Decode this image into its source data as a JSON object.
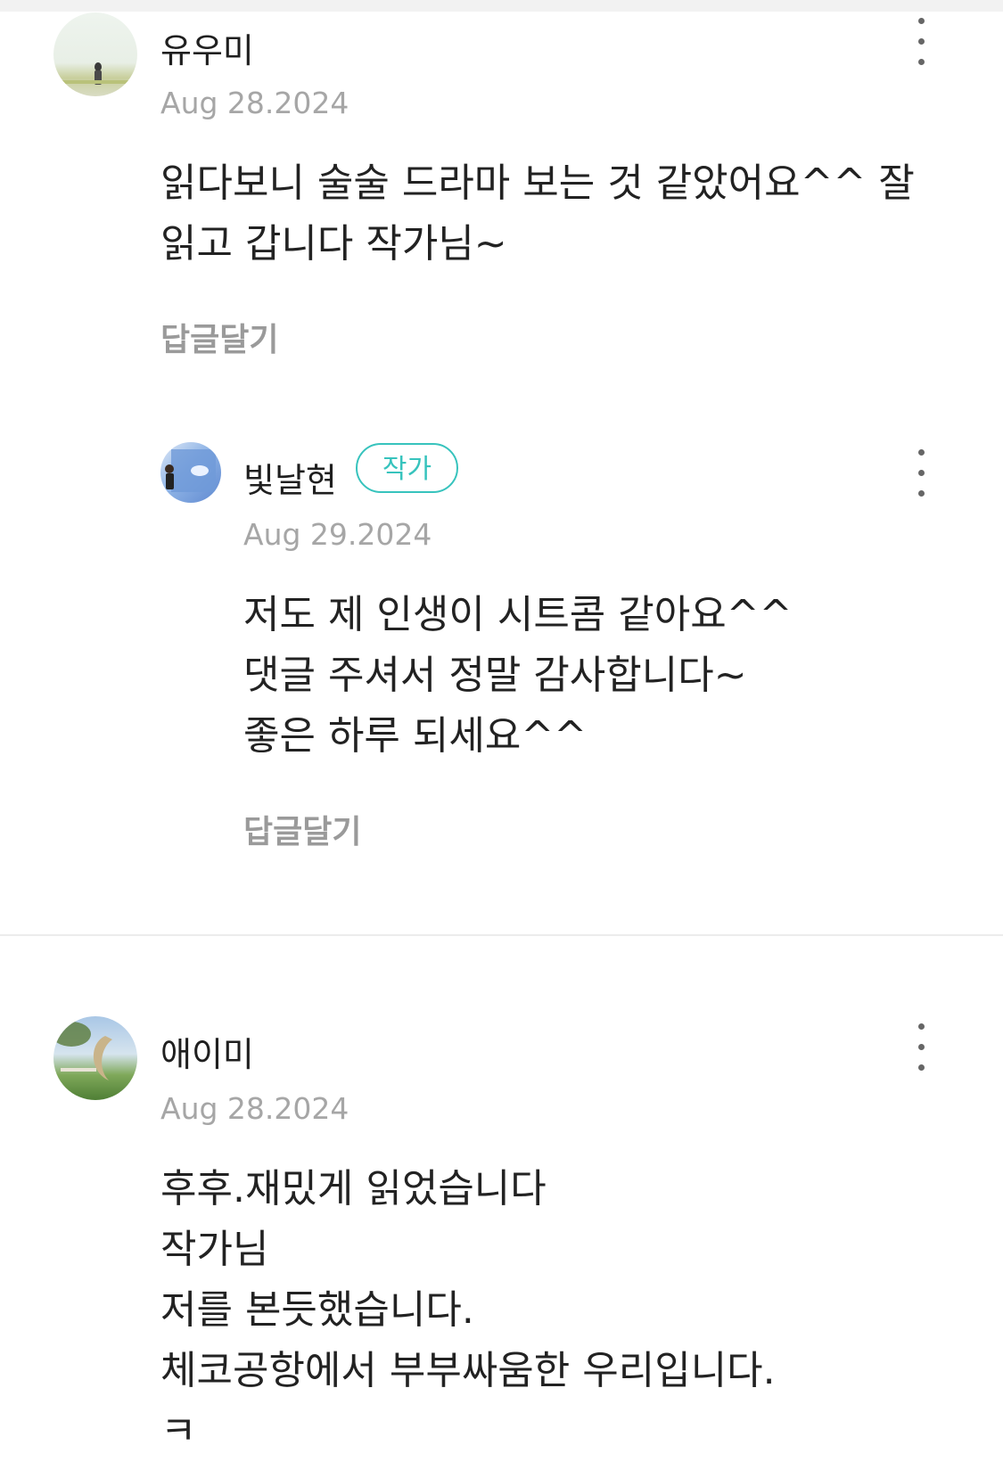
{
  "comments": [
    {
      "author": "유우미",
      "date": "Aug 28.2024",
      "text_lines": [
        "읽다보니 술술 드라마 보는 것 같았어요^^ 잘",
        "읽고 갑니다 작가님~"
      ],
      "reply_label": "답글달기",
      "reply": {
        "author": "빛날현",
        "badge": "작가",
        "date": "Aug 29.2024",
        "text_lines": [
          "저도 제 인생이 시트콤 같아요^^",
          "댓글 주셔서 정말 감사합니다~",
          "좋은 하루 되세요^^"
        ],
        "reply_label": "답글달기"
      }
    },
    {
      "author": "애이미",
      "date": "Aug 28.2024",
      "text_lines": [
        "후후.재밌게 읽었습니다",
        "작가님",
        "저를 본듯했습니다.",
        "체코공항에서 부부싸움한 우리입니다.",
        "ㅋ"
      ]
    }
  ],
  "colors": {
    "accent": "#37c3bd",
    "meta": "#a6a6a6",
    "reply_label": "#9a9a9a",
    "divider": "#ececec"
  },
  "icons": [
    "more-vertical-icon"
  ]
}
